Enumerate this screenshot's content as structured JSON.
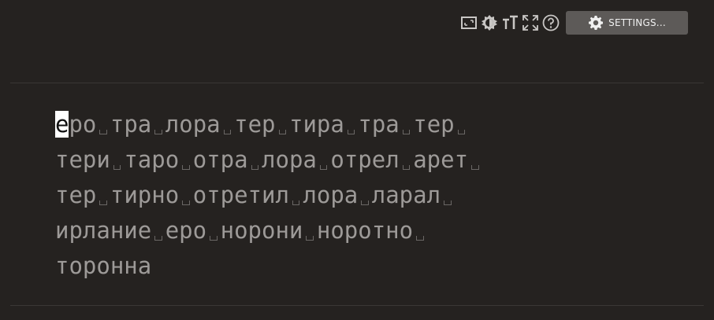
{
  "toolbar": {
    "icons": [
      "window-icon",
      "theme-icon",
      "font-size-icon",
      "fullscreen-icon",
      "help-icon"
    ],
    "settings_label": "SETTINGS..."
  },
  "lesson": {
    "cursor_char": "е",
    "lines": [
      [
        "еро",
        "тра",
        "лора",
        "тер",
        "тира",
        "тра",
        "тер"
      ],
      [
        "тери",
        "таро",
        "отра",
        "лора",
        "отрел",
        "арет"
      ],
      [
        "тер",
        "тирно",
        "отретил",
        "лора",
        "ларал"
      ],
      [
        "ирлание",
        "еро",
        "норони",
        "норотно"
      ],
      [
        "торонна"
      ]
    ]
  },
  "colors": {
    "background": "#252220",
    "text": "#9d9a98",
    "cursor_bg": "#ffffff",
    "button_bg": "#5d5a58"
  }
}
